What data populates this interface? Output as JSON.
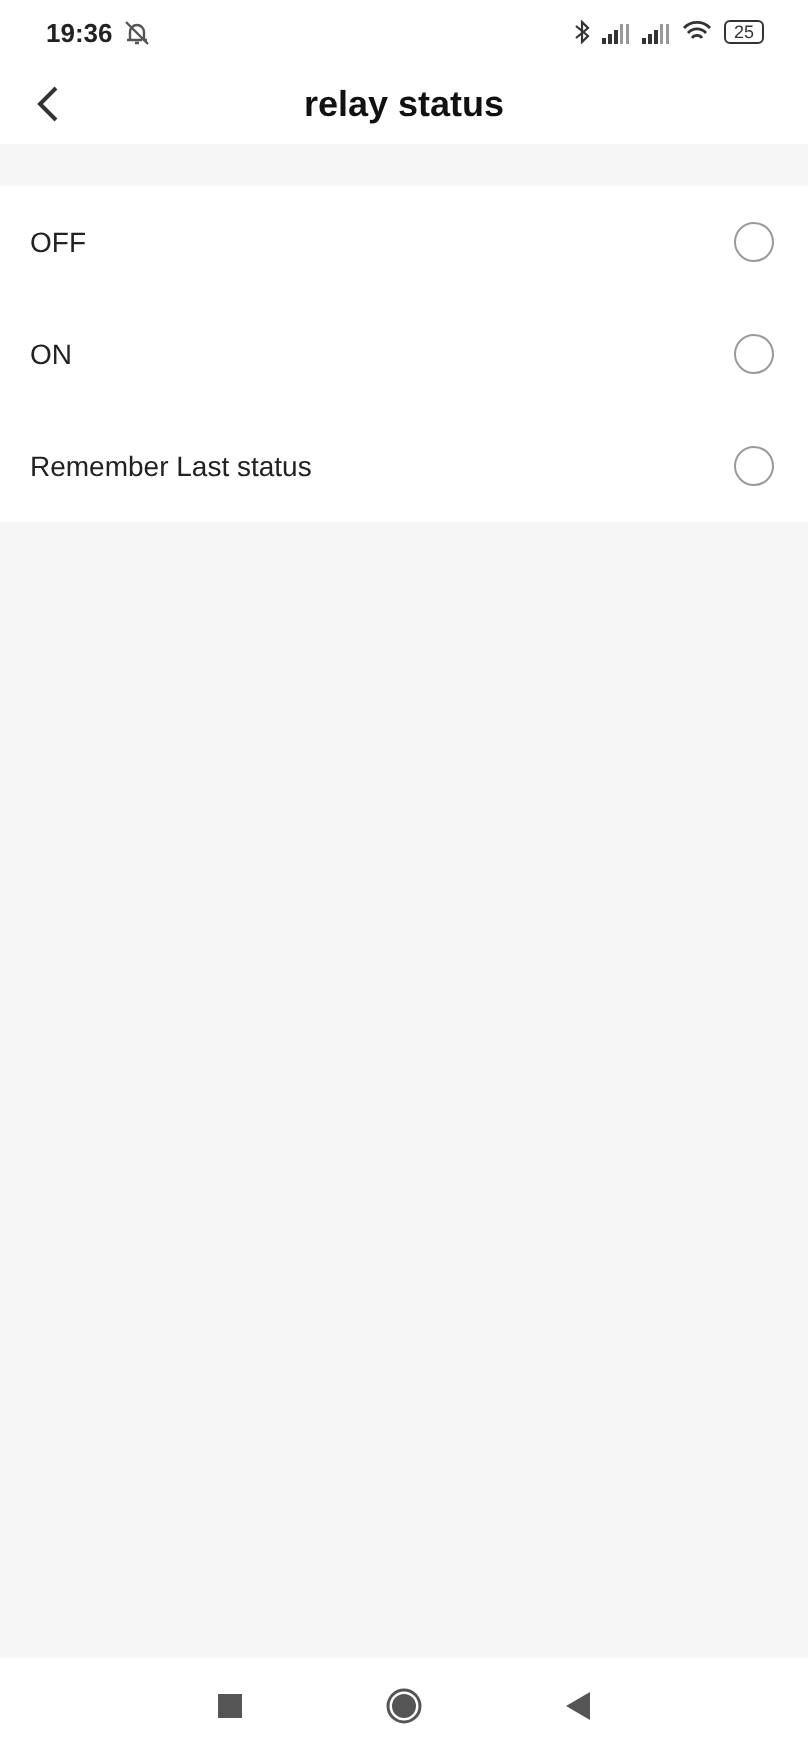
{
  "status_bar": {
    "time": "19:36",
    "battery": "25"
  },
  "header": {
    "title": "relay status"
  },
  "options": [
    {
      "label": "OFF",
      "selected": false
    },
    {
      "label": "ON",
      "selected": false
    },
    {
      "label": "Remember Last status",
      "selected": false
    }
  ]
}
